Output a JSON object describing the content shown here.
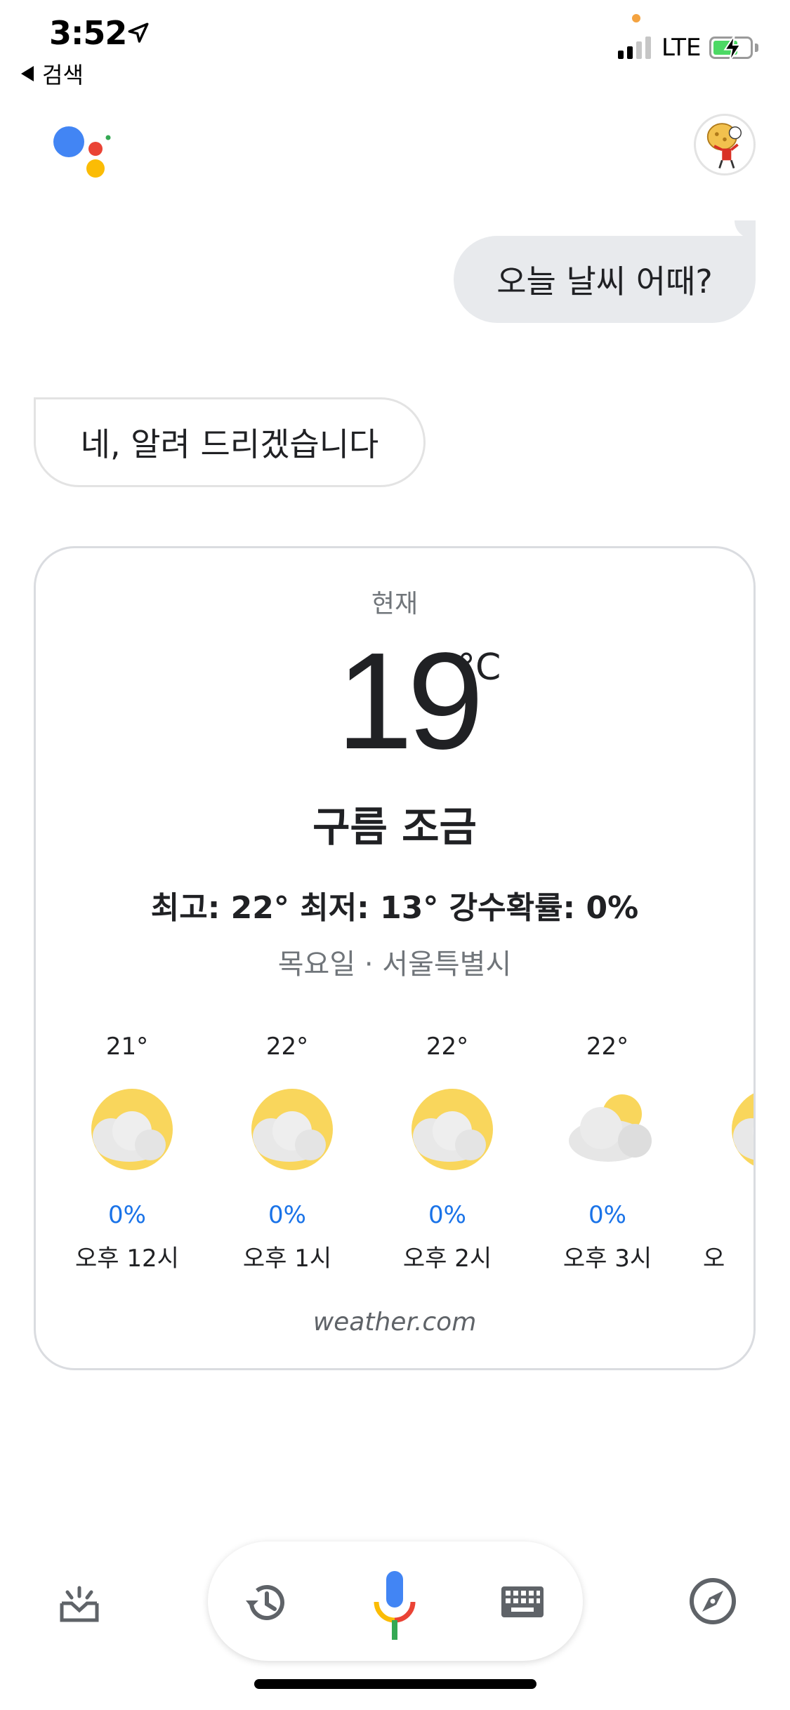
{
  "status_bar": {
    "time": "3:52",
    "back_label": "검색",
    "network": "LTE",
    "signal_bars_active": 2,
    "signal_bars_total": 4,
    "battery_color": "#4cd964"
  },
  "header": {
    "logo_icon": "google-assistant-logo",
    "logo_colors": [
      "#4285f4",
      "#ea4335",
      "#fbbc05",
      "#34a853"
    ],
    "avatar_icon": "user-avatar"
  },
  "conversation": {
    "user_query": "오늘 날씨 어때?",
    "assistant_reply": "네, 알려 드리겠습니다"
  },
  "weather_card": {
    "now_label": "현재",
    "temperature": "19",
    "unit": "°C",
    "condition": "구름 조금",
    "stats": "최고: 22° 최저: 13°  강수확률: 0%",
    "day_place": "목요일 · 서울특별시",
    "hourly": [
      {
        "temp": "21°",
        "icon": "partly-cloudy-sun-icon",
        "precip": "0%",
        "time": "오후 12시"
      },
      {
        "temp": "22°",
        "icon": "partly-cloudy-sun-icon",
        "precip": "0%",
        "time": "오후 1시"
      },
      {
        "temp": "22°",
        "icon": "partly-cloudy-sun-icon",
        "precip": "0%",
        "time": "오후 2시"
      },
      {
        "temp": "22°",
        "icon": "mostly-cloudy-icon",
        "precip": "0%",
        "time": "오후 3시"
      },
      {
        "temp": "",
        "icon": "partly-cloudy-sun-icon",
        "precip": "",
        "time": "오"
      }
    ],
    "source": "weather.com",
    "precip_color": "#1a73e8"
  },
  "bottom_bar": {
    "left_icon": "updates-tray-icon",
    "history_icon": "history-icon",
    "mic_icon": "microphone-icon",
    "keyboard_icon": "keyboard-icon",
    "explore_icon": "compass-icon"
  }
}
